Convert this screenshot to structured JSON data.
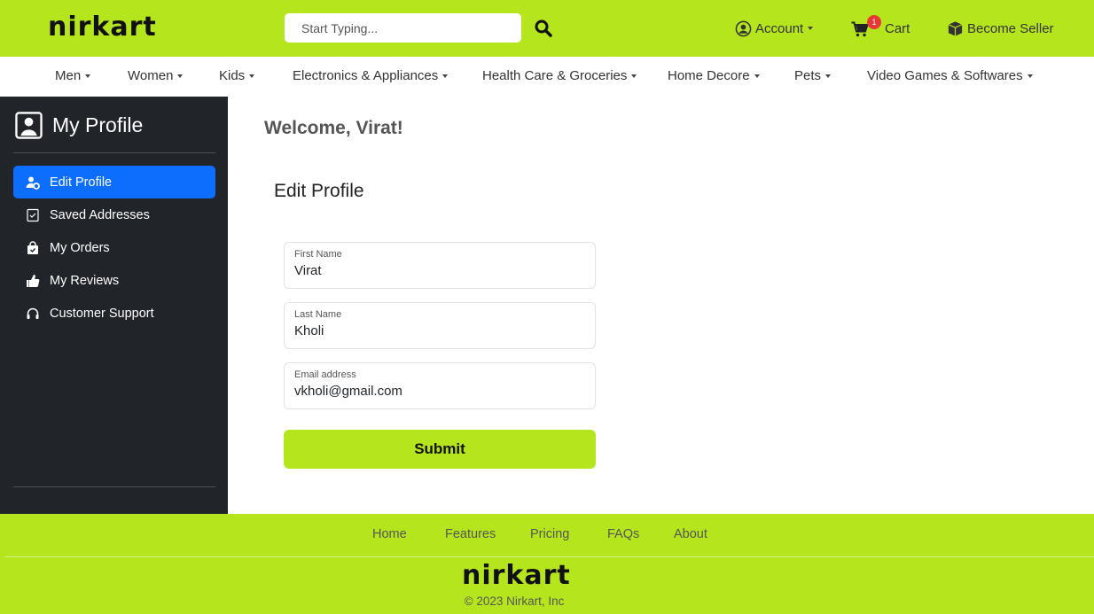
{
  "brand": {
    "name": "nirkart",
    "accent_color": "#b5e61d",
    "sidebar_color": "#212529",
    "active_color": "#0d6efd"
  },
  "header": {
    "search_placeholder": "Start Typing...",
    "search_icon": "search-icon",
    "account_label": "Account",
    "account_icon": "user-circle-icon",
    "cart_label": "Cart",
    "cart_icon": "cart-icon",
    "cart_count": "1",
    "seller_label": "Become Seller",
    "seller_icon": "box-icon"
  },
  "categories": [
    {
      "label": "Men"
    },
    {
      "label": "Women"
    },
    {
      "label": "Kids"
    },
    {
      "label": "Electronics & Appliances"
    },
    {
      "label": "Health Care & Groceries"
    },
    {
      "label": "Home Decore"
    },
    {
      "label": "Pets"
    },
    {
      "label": "Video Games & Softwares"
    }
  ],
  "sidebar": {
    "title": "My Profile",
    "title_icon": "person-square-icon",
    "items": [
      {
        "label": "Edit Profile",
        "icon": "user-gear-icon",
        "active": true
      },
      {
        "label": "Saved Addresses",
        "icon": "address-card-icon",
        "active": false
      },
      {
        "label": "My Orders",
        "icon": "bag-icon",
        "active": false
      },
      {
        "label": "My Reviews",
        "icon": "thumbs-up-icon",
        "active": false
      },
      {
        "label": "Customer Support",
        "icon": "headset-icon",
        "active": false
      }
    ]
  },
  "main": {
    "welcome": "Welcome, Virat!",
    "form_title": "Edit Profile",
    "fields": [
      {
        "label": "First Name",
        "value": "Virat"
      },
      {
        "label": "Last Name",
        "value": "Kholi"
      },
      {
        "label": "Email address",
        "value": "vkholi@gmail.com"
      }
    ],
    "submit_label": "Submit"
  },
  "footer": {
    "links": [
      {
        "label": "Home"
      },
      {
        "label": "Features"
      },
      {
        "label": "Pricing"
      },
      {
        "label": "FAQs"
      },
      {
        "label": "About"
      }
    ],
    "copyright": "© 2023 Nirkart, Inc"
  }
}
